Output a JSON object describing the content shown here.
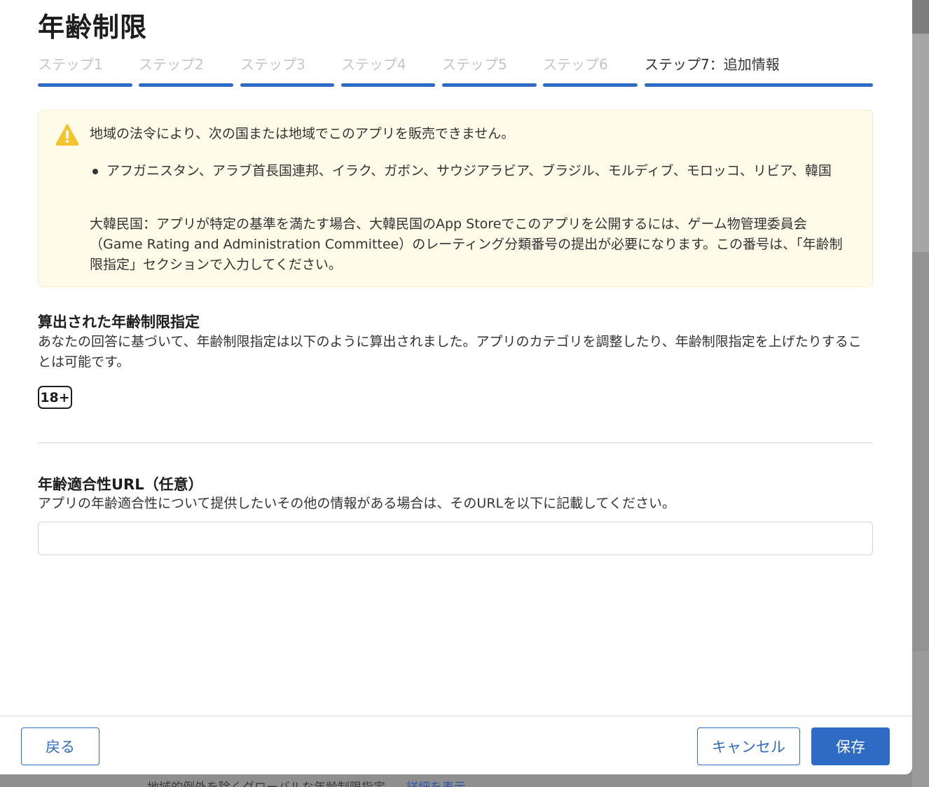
{
  "dialog": {
    "title": "年齢制限"
  },
  "steps": [
    {
      "label": "ステップ1",
      "active": false
    },
    {
      "label": "ステップ2",
      "active": false
    },
    {
      "label": "ステップ3",
      "active": false
    },
    {
      "label": "ステップ4",
      "active": false
    },
    {
      "label": "ステップ5",
      "active": false
    },
    {
      "label": "ステップ6",
      "active": false
    },
    {
      "label": "ステップ7：追加情報",
      "active": true
    }
  ],
  "notice": {
    "icon": "warning-icon",
    "line1": "地域の法令により、次の国または地域でこのアプリを販売できません。",
    "countries": "アフガニスタン、アラブ首長国連邦、イラク、ガボン、サウジアラビア、ブラジル、モルディブ、モロッコ、リビア、韓国",
    "korea_note": "大韓民国：アプリが特定の基準を満たす場合、大韓民国のApp Storeでこのアプリを公開するには、ゲーム物管理委員会（Game Rating and Administration Committee）のレーティング分類番号の提出が必要になります。この番号は、「年齢制限指定」セクションで入力してください。"
  },
  "calculated_rating": {
    "title": "算出された年齢制限指定",
    "description": "あなたの回答に基づいて、年齢制限指定は以下のように算出されました。アプリのカテゴリを調整したり、年齢制限指定を上げたりすることは可能です。",
    "badge": "18+"
  },
  "age_url": {
    "title": "年齢適合性URL（任意）",
    "description": "アプリの年齢適合性について提供したいその他の情報がある場合は、そのURLを以下に記載してください。",
    "value": ""
  },
  "footer": {
    "back_label": "戻る",
    "cancel_label": "キャンセル",
    "save_label": "保存"
  },
  "background": {
    "partial_text": "地域的例外を除くグローバルな年齢制限指定",
    "partial_link": "詳細を表示"
  },
  "colors": {
    "accent": "#2d6bc4",
    "notice_bg": "#fefbe8",
    "warning": "#f4c430"
  }
}
